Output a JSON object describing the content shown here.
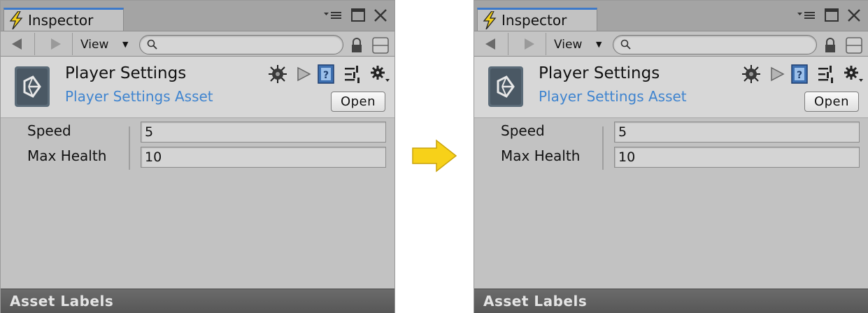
{
  "panels": [
    {
      "tab_title": "Inspector",
      "toolbar": {
        "view_label": "View",
        "search_value": ""
      },
      "header": {
        "title": "Player Settings",
        "subtitle": "Player Settings Asset",
        "open_label": "Open"
      },
      "fields": [
        {
          "label": "Speed",
          "value": "5"
        },
        {
          "label": "Max Health",
          "value": "10"
        }
      ],
      "footer_label": "Asset Labels"
    },
    {
      "tab_title": "Inspector",
      "toolbar": {
        "view_label": "View",
        "search_value": ""
      },
      "header": {
        "title": "Player Settings",
        "subtitle": "Player Settings Asset",
        "open_label": "Open"
      },
      "fields": [
        {
          "label": "Speed",
          "value": "5"
        },
        {
          "label": "Max Health",
          "value": "10"
        }
      ],
      "footer_label": "Asset Labels"
    }
  ],
  "colors": {
    "panel_bg": "#c2c2c2",
    "tab_accent": "#3d79c9",
    "subtitle": "#3f84cf",
    "footer_bg": "#5f5f5f",
    "arrow": "#f7d119"
  },
  "icons": {
    "tab": "lightning-bolt-icon",
    "transition": "right-arrow-icon",
    "asset": "unity-logo-icon",
    "header": [
      "debug-bug-icon",
      "play-icon",
      "help-book-icon",
      "preset-sliders-icon",
      "gear-icon"
    ]
  }
}
